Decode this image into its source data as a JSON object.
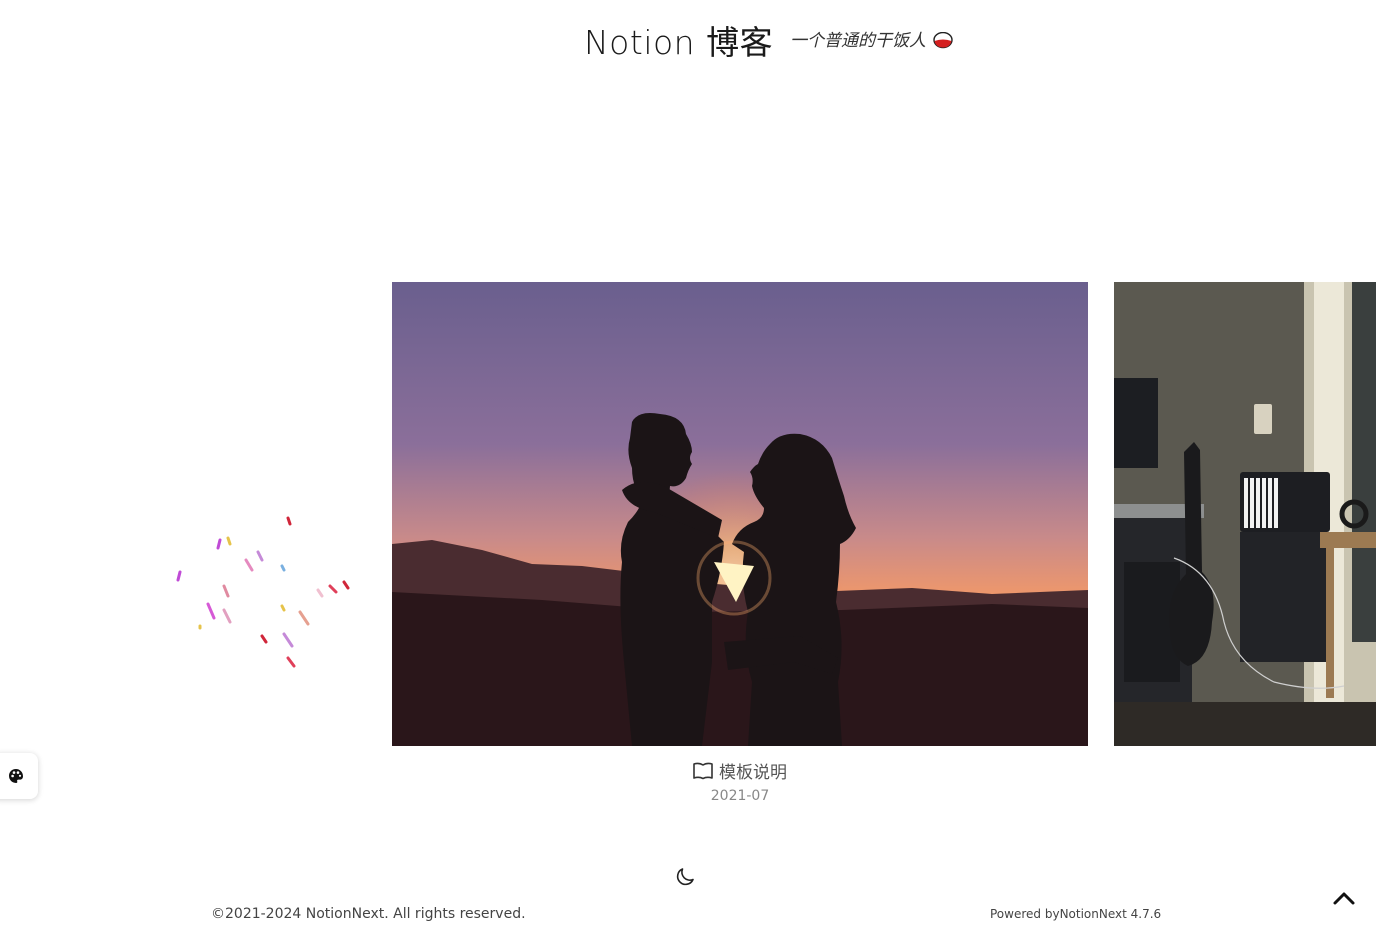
{
  "header": {
    "title": "Notion 博客",
    "subtitle": "一个普通的干饭人",
    "subtitle_icon": "rice-bowl-icon"
  },
  "slider": {
    "active_slide": {
      "title": "模板说明",
      "date": "2021-07",
      "icon": "book-icon"
    }
  },
  "footer": {
    "copyright": "©2021-2024 NotionNext. All rights reserved.",
    "powered_prefix": "Powered by",
    "powered_link": "NotionNext 4.7.6"
  },
  "controls": {
    "theme_icon": "palette-icon",
    "dark_mode_icon": "moon-icon",
    "back_to_top_icon": "chevron-up-icon"
  }
}
